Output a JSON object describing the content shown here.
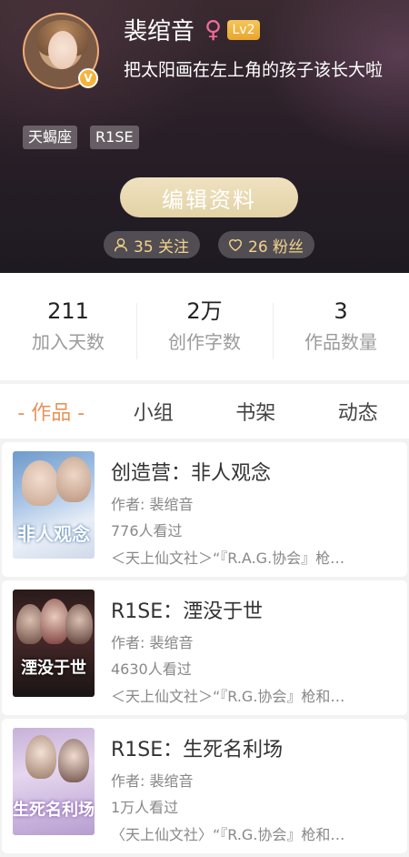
{
  "profile": {
    "username": "裴绾音",
    "gender_symbol": "♀",
    "level": "Lv2",
    "verified_badge": "V",
    "bio": "把太阳画在左上角的孩子该长大啦",
    "tags": [
      "天蝎座",
      "R1SE"
    ],
    "edit_button": "编辑资料",
    "following": "35 关注",
    "fans": "26 粉丝"
  },
  "stats": [
    {
      "value": "211",
      "label": "加入天数"
    },
    {
      "value": "2万",
      "label": "创作字数"
    },
    {
      "value": "3",
      "label": "作品数量"
    }
  ],
  "tabs": [
    {
      "label": "- 作品 -",
      "active": true
    },
    {
      "label": "小组",
      "active": false
    },
    {
      "label": "书架",
      "active": false
    },
    {
      "label": "动态",
      "active": false
    }
  ],
  "works": [
    {
      "title": "创造营：非人观念",
      "author": "作者: 裴绾音",
      "views": "776人看过",
      "tagline": "＜天上仙文社＞“『R.A.G.协会』枪…",
      "cover_text": "非人观念"
    },
    {
      "title": "R1SE：湮没于世",
      "author": "作者: 裴绾音",
      "views": "4630人看过",
      "tagline": "＜天上仙文社＞“『R.G.协会』枪和…",
      "cover_text": "湮没于世"
    },
    {
      "title": "R1SE：生死名利场",
      "author": "作者: 裴绾音",
      "views": "1万人看过",
      "tagline": "〈天上仙文社〉“『R.G.协会』枪和…",
      "cover_text": "生死名利场"
    }
  ],
  "colors": {
    "accent": "#e8935a",
    "gold": "#f2d48a",
    "gender": "#f16b9c"
  }
}
